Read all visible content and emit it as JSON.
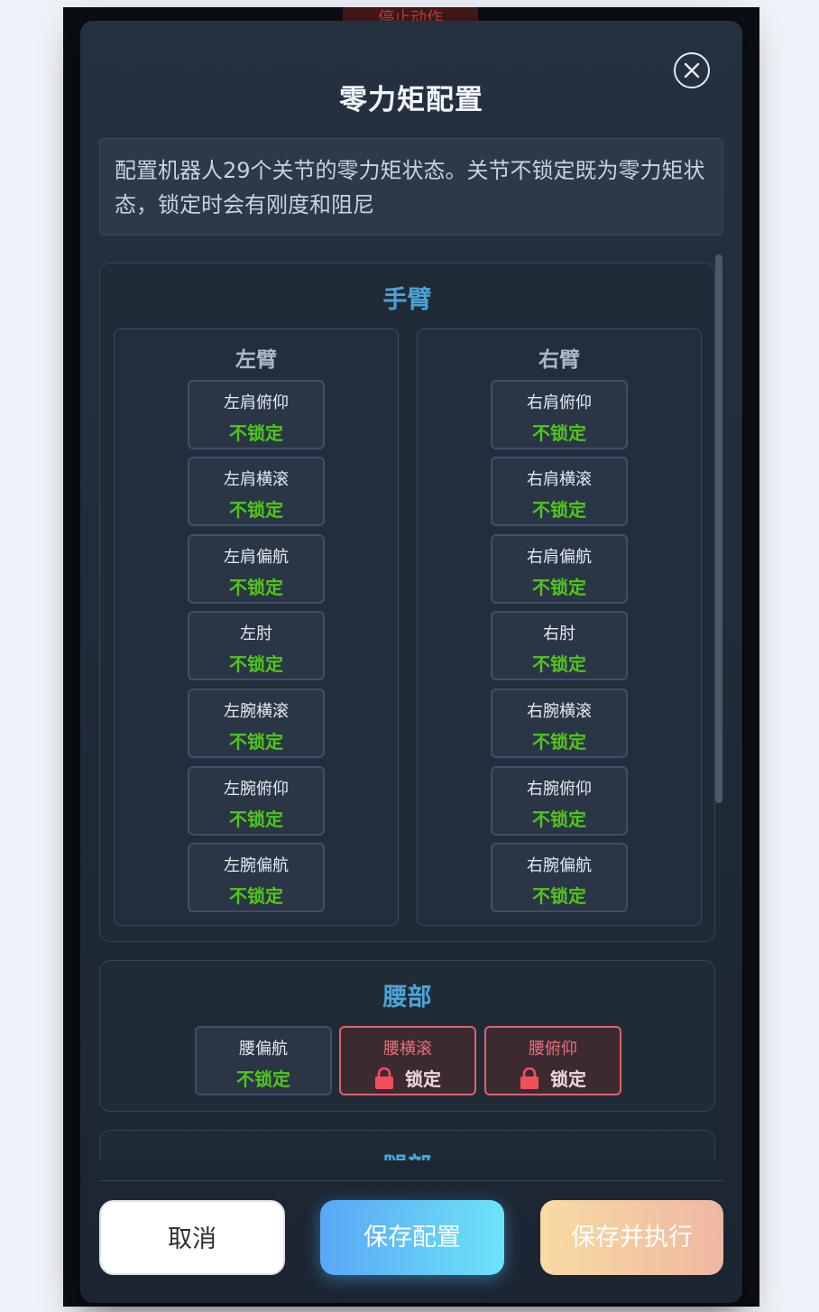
{
  "backdrop": {
    "title": "停止动作"
  },
  "modal": {
    "title": "零力矩配置",
    "description": "配置机器人29个关节的零力矩状态。关节不锁定既为零力矩状态，锁定时会有刚度和阻尼"
  },
  "arms": {
    "title": "手臂",
    "left": {
      "title": "左臂",
      "joints": [
        {
          "name": "左肩俯仰",
          "state": "不锁定"
        },
        {
          "name": "左肩横滚",
          "state": "不锁定"
        },
        {
          "name": "左肩偏航",
          "state": "不锁定"
        },
        {
          "name": "左肘",
          "state": "不锁定"
        },
        {
          "name": "左腕横滚",
          "state": "不锁定"
        },
        {
          "name": "左腕俯仰",
          "state": "不锁定"
        },
        {
          "name": "左腕偏航",
          "state": "不锁定"
        }
      ]
    },
    "right": {
      "title": "右臂",
      "joints": [
        {
          "name": "右肩俯仰",
          "state": "不锁定"
        },
        {
          "name": "右肩横滚",
          "state": "不锁定"
        },
        {
          "name": "右肩偏航",
          "state": "不锁定"
        },
        {
          "name": "右肘",
          "state": "不锁定"
        },
        {
          "name": "右腕横滚",
          "state": "不锁定"
        },
        {
          "name": "右腕俯仰",
          "state": "不锁定"
        },
        {
          "name": "右腕偏航",
          "state": "不锁定"
        }
      ]
    }
  },
  "waist": {
    "title": "腰部",
    "joints": [
      {
        "name": "腰偏航",
        "state": "不锁定"
      },
      {
        "name": "腰横滚",
        "state": "锁定"
      },
      {
        "name": "腰俯仰",
        "state": "锁定"
      }
    ]
  },
  "legs": {
    "title": "腿部"
  },
  "buttons": {
    "cancel": "取消",
    "save": "保存配置",
    "save_execute": "保存并执行"
  },
  "colors": {
    "unlocked": "#52c41a",
    "locked": "#e0606c",
    "section_title": "#4ba3d6"
  }
}
